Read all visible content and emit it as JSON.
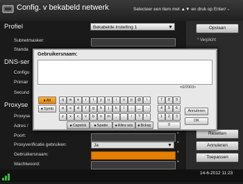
{
  "header": {
    "title": "Config. v bekabeld netwerk",
    "hint": "Selecteer een item met ▲▼ en druk op Enter/→"
  },
  "sections": {
    "profiel": "Profiel",
    "dns": "DNS-ser",
    "proxy": "Proxyse"
  },
  "profile_select": {
    "value": "Bekabelde instelling 1"
  },
  "fields": {
    "subnetmasker": "Subnetmasker:",
    "standaard": "Standa",
    "configu": "Configu",
    "primair": "Primair",
    "secundair": "Secund",
    "proxyserver": "Proxyse",
    "adres": "Adres /",
    "poort": "Poort:",
    "proxyverificatie": "Proxyverificatie gebruiken:",
    "proxyverificatie_value": "Ja",
    "gebruikersnaam": "Gebruikersnaam:",
    "wachtwoord": "Wachtwoord:"
  },
  "right_panel": {
    "save": "Opslaan",
    "required": "* Verplicht",
    "reset": "Resetten",
    "cancel": "Annuleren",
    "apply": "Toepassen"
  },
  "footer": {
    "datetime": "14-6-2012 11:23"
  },
  "dialog": {
    "title": "Gebruikersnaam:",
    "value": "",
    "counter": "<0/2003>",
    "cancel": "Annuleren",
    "ok": "OK"
  },
  "keyboard": {
    "mode_alt": "Alt",
    "mode_symb": "Symb",
    "row1": [
      "q",
      "w",
      "e",
      "r",
      "t",
      "y",
      "u",
      "i",
      "o",
      "p",
      "@",
      "\\"
    ],
    "row2": [
      "a",
      "s",
      "d",
      "f",
      "g",
      "h",
      "j",
      "k",
      "l",
      "-",
      "_",
      ":"
    ],
    "row3": [
      "z",
      "x",
      "c",
      "v",
      "b",
      "n",
      "m",
      ",",
      ".",
      "/",
      "?",
      "!"
    ],
    "bottom": [
      "Capslck",
      "Spatie",
      "Alles wis",
      "Bcksp"
    ],
    "numpad": [
      "7",
      "8",
      "9",
      "4",
      "5",
      "6",
      "1",
      "2",
      "3",
      "0"
    ]
  },
  "colors": {
    "accent": "#e57f00",
    "header_bg": "#2a2a2a",
    "dialog_bg": "#e8e8e8"
  }
}
